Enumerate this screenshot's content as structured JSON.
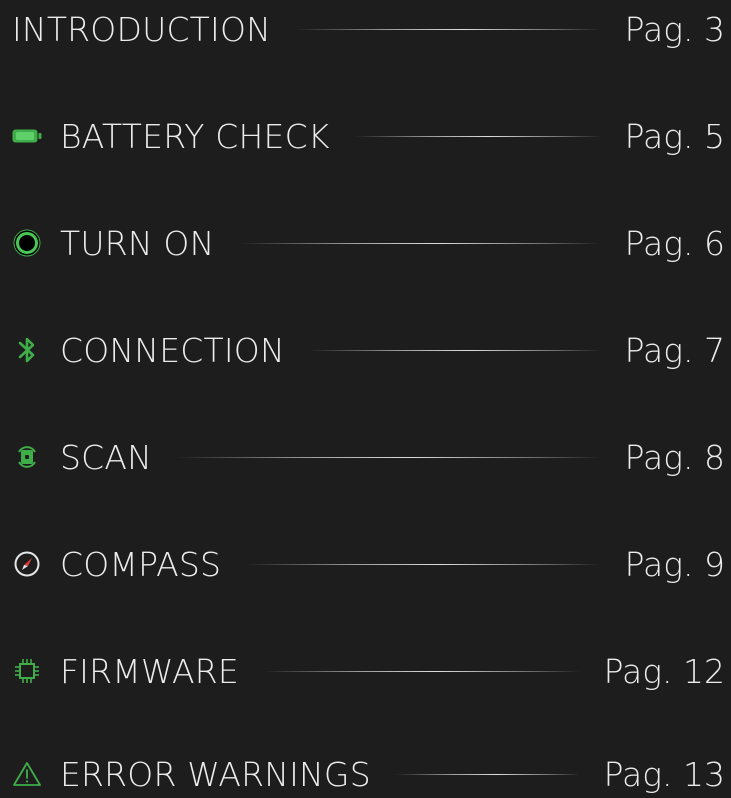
{
  "colors": {
    "background": "#1d1d1d",
    "text": "#ececec",
    "accent_green": "#3fae49"
  },
  "toc": {
    "items": [
      {
        "title": "INTRODUCTION",
        "page": "Pag. 3",
        "icon": ""
      },
      {
        "title": "BATTERY CHECK",
        "page": "Pag. 5",
        "icon": "battery-icon"
      },
      {
        "title": "TURN ON",
        "page": "Pag. 6",
        "icon": "power-ring-icon"
      },
      {
        "title": "CONNECTION",
        "page": "Pag. 7",
        "icon": "bluetooth-icon"
      },
      {
        "title": "SCAN",
        "page": "Pag. 8",
        "icon": "scan-icon"
      },
      {
        "title": "COMPASS",
        "page": "Pag. 9",
        "icon": "compass-icon"
      },
      {
        "title": "FIRMWARE",
        "page": "Pag. 12",
        "icon": "chip-icon"
      },
      {
        "title": "ERROR WARNINGS",
        "page": "Pag. 13",
        "icon": "warning-icon"
      }
    ]
  }
}
